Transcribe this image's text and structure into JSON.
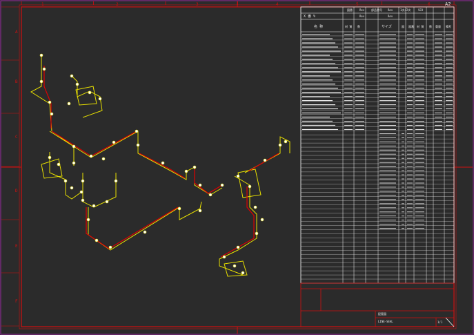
{
  "sheet": {
    "size_label": "A2",
    "top_ruler": [
      "1",
      "2",
      "3",
      "4",
      "5",
      "6"
    ],
    "left_ruler": [
      "A",
      "B",
      "C",
      "D",
      "E",
      "F"
    ],
    "colors": {
      "background": "#2b2b2b",
      "frame": "#d01010",
      "pipe": "#e8e000",
      "flow_line": "#e00000",
      "table_line": "#ffffff",
      "text": "#e8e8e8"
    }
  },
  "parts_table": {
    "header_top": {
      "row1": [
        "図番",
        "Rev",
        "部品番号",
        "Rev",
        "1次/2次",
        "SCH"
      ],
      "row2": [
        "Rev",
        "Rev"
      ]
    },
    "header_left": "X 番     %",
    "columns": [
      "名 称",
      "材 質",
      "数",
      "サイズ",
      "図",
      "図番",
      "材 質",
      "数",
      "重量",
      "備考"
    ],
    "filled_rows": 24,
    "total_rows": 61
  },
  "title_block": {
    "drawing_title": "配管図",
    "drawing_number": "LINE-SEAL",
    "sheet_no": "1/1"
  }
}
